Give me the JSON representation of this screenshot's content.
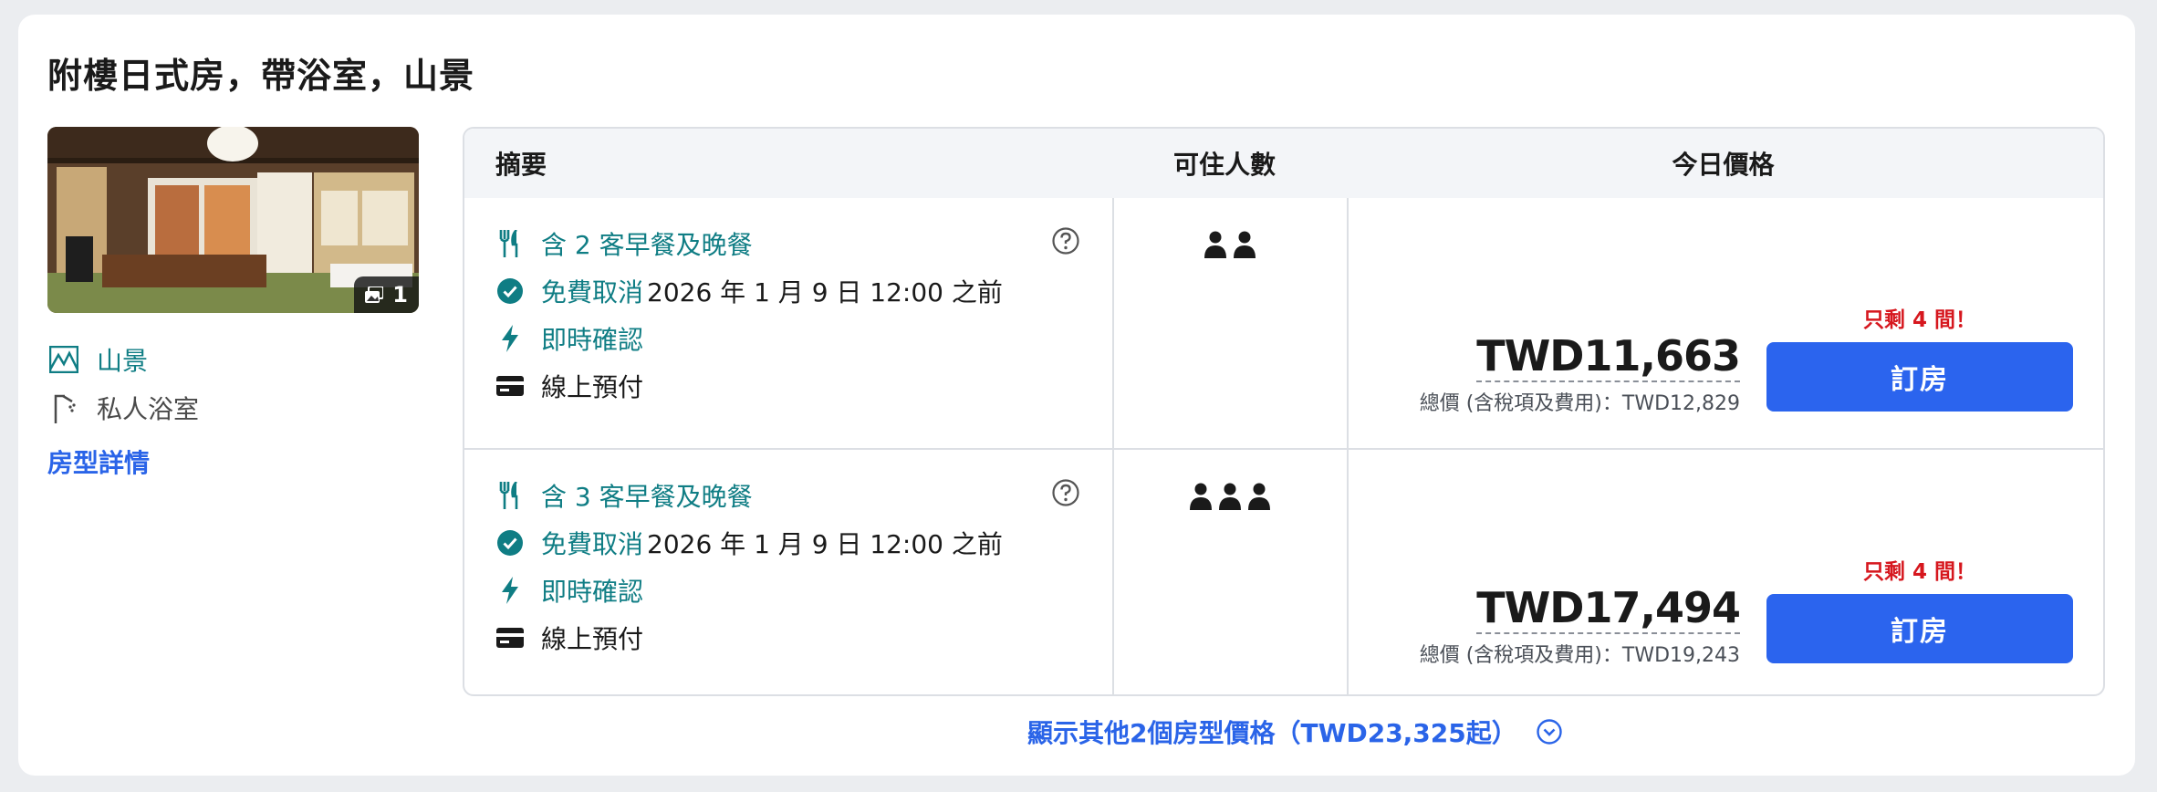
{
  "room": {
    "title": "附樓日式房，帶浴室，山景",
    "photo_count": "1",
    "features": [
      {
        "icon": "mountain-view-icon",
        "label": "山景"
      },
      {
        "icon": "shower-icon",
        "label": "私人浴室"
      }
    ],
    "details_link": "房型詳情"
  },
  "table": {
    "headers": {
      "summary": "摘要",
      "occupancy": "可住人數",
      "price": "今日價格"
    },
    "rows": [
      {
        "meal": "含 2 客早餐及晚餐",
        "cancel_label": "免費取消",
        "cancel_deadline": "2026 年 1 月 9 日 12:00 之前",
        "instant": "即時確認",
        "payment": "線上預付",
        "guests": 2,
        "scarcity": "只剩 4 間！",
        "price": "TWD11,663",
        "total": "總價 (含稅項及費用)：TWD12,829",
        "book": "訂房"
      },
      {
        "meal": "含 3 客早餐及晚餐",
        "cancel_label": "免費取消",
        "cancel_deadline": "2026 年 1 月 9 日 12:00 之前",
        "instant": "即時確認",
        "payment": "線上預付",
        "guests": 3,
        "scarcity": "只剩 4 間！",
        "price": "TWD17,494",
        "total": "總價 (含稅項及費用)：TWD19,243",
        "book": "訂房"
      }
    ]
  },
  "more_link": "顯示其他2個房型價格（TWD23,325起）",
  "colors": {
    "accent_blue": "#2b64ee",
    "teal": "#0f7d84",
    "alert_red": "#d6171e"
  }
}
